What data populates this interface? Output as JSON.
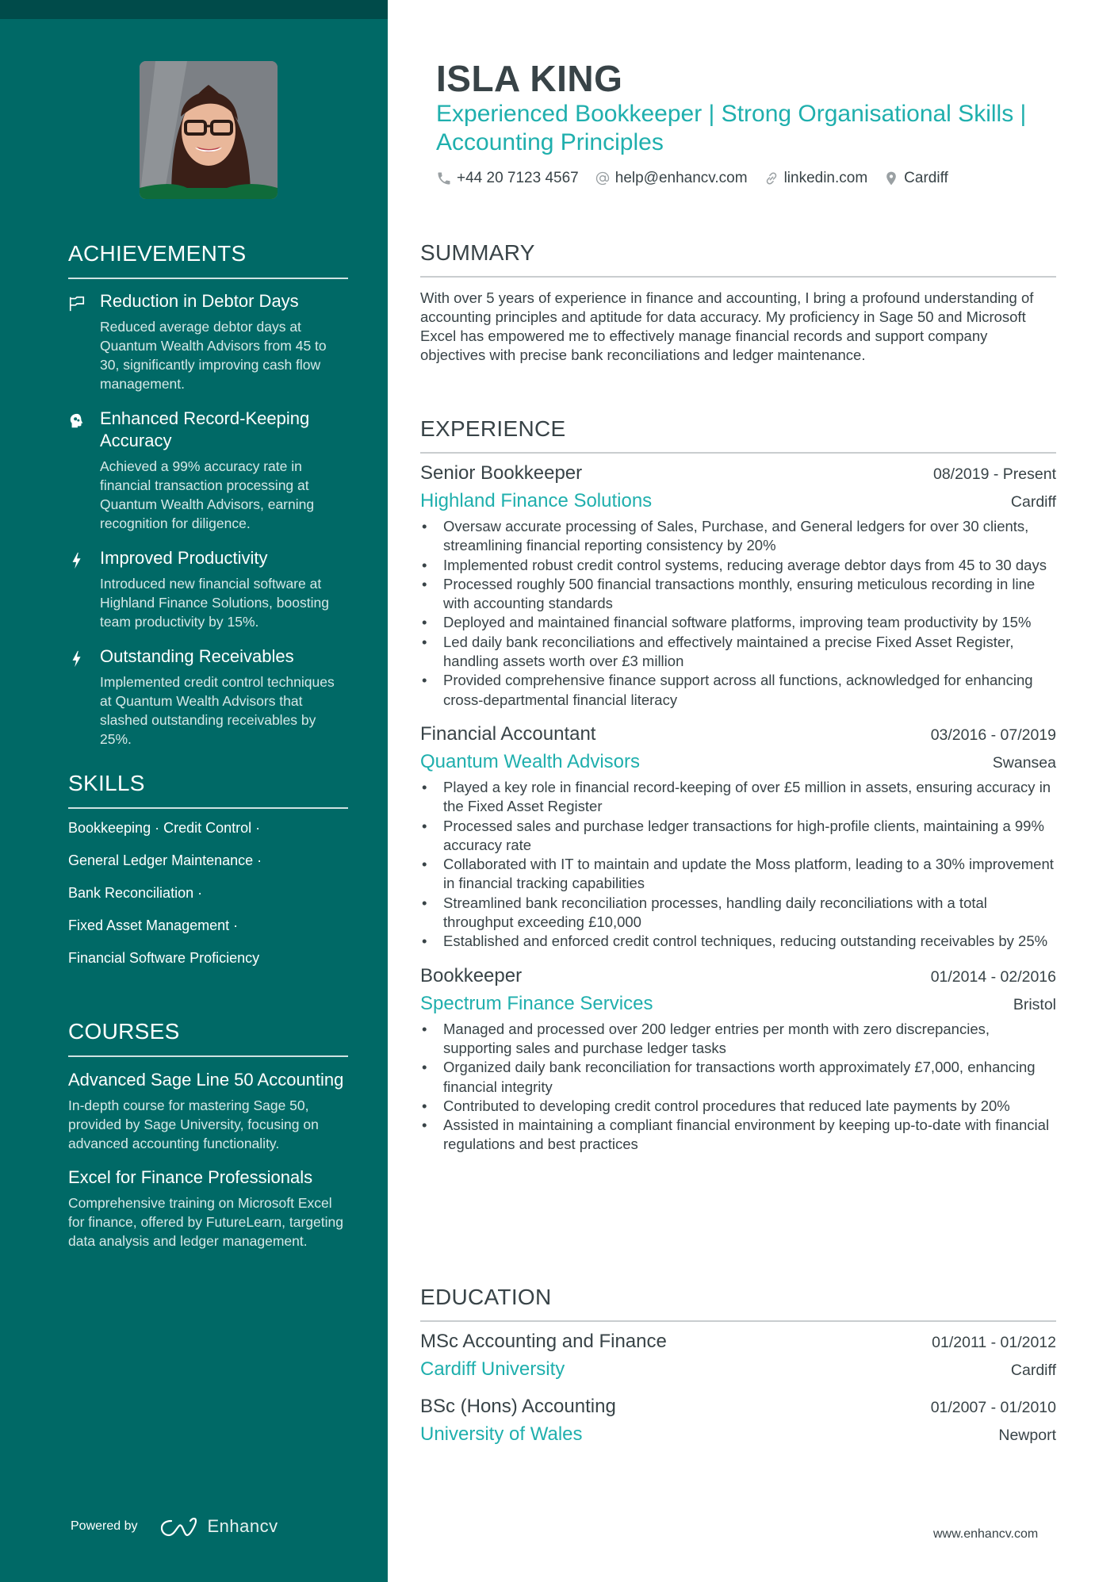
{
  "colors": {
    "sidebar": "#006966",
    "sidebar_top": "#004b4a",
    "accent": "#1fafad",
    "text": "#384347"
  },
  "profile": {
    "name": "ISLA KING",
    "headline": "Experienced Bookkeeper | Strong Organisational Skills | Accounting Principles",
    "photo_alt": "Profile photo",
    "contacts": [
      {
        "icon": "phone-icon",
        "text": "+44 20 7123 4567"
      },
      {
        "icon": "at-icon",
        "text": "help@enhancv.com"
      },
      {
        "icon": "link-icon",
        "text": "linkedin.com"
      },
      {
        "icon": "location-pin-icon",
        "text": "Cardiff"
      }
    ]
  },
  "sidebar": {
    "achievements": {
      "title": "ACHIEVEMENTS",
      "items": [
        {
          "icon": "flag-icon",
          "title": "Reduction in Debtor Days",
          "desc": "Reduced average debtor days at Quantum Wealth Advisors from 45 to 30, significantly improving cash flow management."
        },
        {
          "icon": "brain-head-icon",
          "title": "Enhanced Record-Keeping Accuracy",
          "desc": "Achieved a 99% accuracy rate in financial transaction processing at Quantum Wealth Advisors, earning recognition for diligence."
        },
        {
          "icon": "lightning-icon",
          "title": "Improved Productivity",
          "desc": "Introduced new financial software at Highland Finance Solutions, boosting team productivity by 15%."
        },
        {
          "icon": "lightning-icon",
          "title": "Outstanding Receivables",
          "desc": "Implemented credit control techniques at Quantum Wealth Advisors that slashed outstanding receivables by 25%."
        }
      ]
    },
    "skills": {
      "title": "SKILLS",
      "rows": [
        "Bookkeeping · Credit Control ·",
        "General Ledger Maintenance ·",
        "Bank Reconciliation ·",
        "Fixed Asset Management ·",
        "Financial Software Proficiency"
      ]
    },
    "courses": {
      "title": "COURSES",
      "items": [
        {
          "title": "Advanced Sage Line 50 Accounting",
          "desc": "In-depth course for mastering Sage 50, provided by Sage University, focusing on advanced accounting functionality."
        },
        {
          "title": "Excel for Finance Professionals",
          "desc": "Comprehensive training on Microsoft Excel for finance, offered by FutureLearn, targeting data analysis and ledger management."
        }
      ]
    },
    "powered_by": {
      "label": "Powered by",
      "brand": "Enhancv"
    }
  },
  "summary": {
    "title": "SUMMARY",
    "text": "With over 5 years of experience in finance and accounting, I bring a profound understanding of accounting principles and aptitude for data accuracy. My proficiency in Sage 50 and Microsoft Excel has empowered me to effectively manage financial records and support company objectives with precise bank reconciliations and ledger maintenance."
  },
  "experience": {
    "title": "EXPERIENCE",
    "jobs": [
      {
        "title": "Senior Bookkeeper",
        "dates": "08/2019 - Present",
        "company": "Highland Finance Solutions",
        "location": "Cardiff",
        "bullets": [
          "Oversaw accurate processing of Sales, Purchase, and General ledgers for over 30 clients, streamlining financial reporting consistency by 20%",
          "Implemented robust credit control systems, reducing average debtor days from 45 to 30 days",
          "Processed roughly 500 financial transactions monthly, ensuring meticulous recording in line with accounting standards",
          "Deployed and maintained financial software platforms, improving team productivity by 15%",
          "Led daily bank reconciliations and effectively maintained a precise Fixed Asset Register, handling assets worth over £3 million",
          "Provided comprehensive finance support across all functions, acknowledged for enhancing cross-departmental financial literacy"
        ]
      },
      {
        "title": "Financial Accountant",
        "dates": "03/2016 - 07/2019",
        "company": "Quantum Wealth Advisors",
        "location": "Swansea",
        "bullets": [
          "Played a key role in financial record-keeping of over £5 million in assets, ensuring accuracy in the Fixed Asset Register",
          "Processed sales and purchase ledger transactions for high-profile clients, maintaining a 99% accuracy rate",
          "Collaborated with IT to maintain and update the Moss platform, leading to a 30% improvement in financial tracking capabilities",
          "Streamlined bank reconciliation processes, handling daily reconciliations with a total throughput exceeding £10,000",
          "Established and enforced credit control techniques, reducing outstanding receivables by 25%"
        ]
      },
      {
        "title": "Bookkeeper",
        "dates": "01/2014 - 02/2016",
        "company": "Spectrum Finance Services",
        "location": "Bristol",
        "bullets": [
          "Managed and processed over 200 ledger entries per month with zero discrepancies, supporting sales and purchase ledger tasks",
          "Organized daily bank reconciliation for transactions worth approximately £7,000, enhancing financial integrity",
          "Contributed to developing credit control procedures that reduced late payments by 20%",
          "Assisted in maintaining a compliant financial environment by keeping up-to-date with financial regulations and best practices"
        ]
      }
    ]
  },
  "education": {
    "title": "EDUCATION",
    "items": [
      {
        "degree": "MSc Accounting and Finance",
        "dates": "01/2011 - 01/2012",
        "school": "Cardiff University",
        "location": "Cardiff"
      },
      {
        "degree": "BSc (Hons) Accounting",
        "dates": "01/2007 - 01/2010",
        "school": "University of Wales",
        "location": "Newport"
      }
    ]
  },
  "footer": {
    "url": "www.enhancv.com"
  }
}
